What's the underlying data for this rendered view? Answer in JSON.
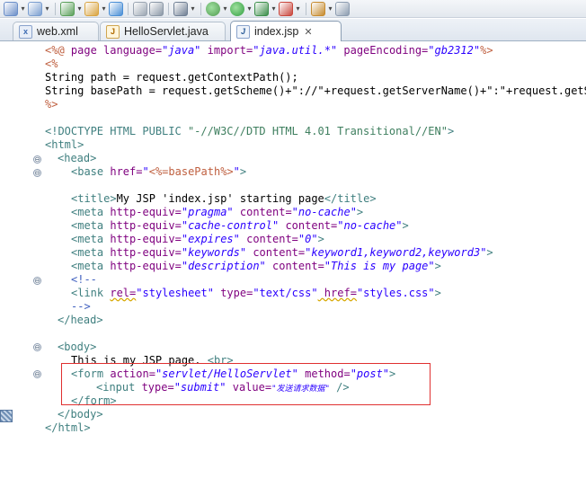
{
  "toolbar": {
    "icons": [
      "new-wizard-icon",
      "dropdown",
      "run-wizard-icon",
      "dropdown",
      "sep",
      "new-class-icon",
      "dropdown",
      "open-type-icon",
      "dropdown",
      "globe-icon",
      "sep",
      "disconnect-icon",
      "search-icon",
      "sep",
      "server-icon",
      "dropdown",
      "sep",
      "debug-icon",
      "dropdown",
      "run-icon",
      "dropdown",
      "coverage-icon",
      "dropdown",
      "external-tools-icon",
      "dropdown",
      "sep",
      "package-icon",
      "dropdown",
      "open-resource-icon"
    ]
  },
  "tabs": [
    {
      "label": "web.xml",
      "icon": "xml-file-icon",
      "active": false
    },
    {
      "label": "HelloServlet.java",
      "icon": "java-file-icon",
      "active": false
    },
    {
      "label": "index.jsp",
      "icon": "jsp-file-icon",
      "active": true,
      "close": "✕"
    }
  ],
  "code": {
    "l1": [
      "<%@ ",
      "page ",
      "language=",
      "\"java\"",
      " import=",
      "\"java.util.*\"",
      " pageEncoding=",
      "\"gb2312\"",
      "%>"
    ],
    "l2": "<%",
    "l3": "String path = request.getContextPath();",
    "l4": "String basePath = request.getScheme()+\"://\"+request.getServerName()+\":\"+request.getSer",
    "l5": "%>",
    "l7a": "<!DOCTYPE HTML PUBLIC ",
    "l7b": "\"-//W3C//DTD HTML 4.01 Transitional//EN\"",
    "l7c": ">",
    "l8": "<html>",
    "l9": "<head>",
    "l10a": "<base ",
    "l10b": "href=",
    "l10c": "\"",
    "l10d": "<%=basePath%>",
    "l10e": "\"",
    "l10f": ">",
    "l12a": "<title>",
    "l12b": "My JSP 'index.jsp' starting page",
    "l12c": "</title>",
    "meta_tag": "<meta ",
    "http_equiv": "http-equiv=",
    "content_attr": "content=",
    "close_gt": ">",
    "m1": [
      "\"pragma\"",
      "\"no-cache\""
    ],
    "m2": [
      "\"cache-control\"",
      "\"no-cache\""
    ],
    "m3": [
      "\"expires\"",
      "\"0\""
    ],
    "m4": [
      "\"keywords\"",
      "\"keyword1,keyword2,keyword3\""
    ],
    "m5": [
      "\"description\"",
      "\"This is my page\""
    ],
    "c1": "<!--",
    "link_tag": "<link ",
    "link_rel": "rel=",
    "link_rel_v": "\"stylesheet\"",
    "link_type": " type=",
    "link_type_v": "\"text/css\"",
    "link_href": " href=",
    "link_href_v": "\"styles.css\"",
    "c2": "-->",
    "l20": "</head>",
    "l22": "<body>",
    "l23a": "This is my JSP page. ",
    "l23b": "<br>",
    "l24a": "<form ",
    "l24b": "action=",
    "l24c": "\"servlet/HelloServlet\"",
    "l24d": " method=",
    "l24e": "\"post\"",
    "l24f": ">",
    "l25a": "<input ",
    "l25b": "type=",
    "l25c": "\"submit\"",
    "l25d": " value=",
    "l25e": "\"发送请求数据\"",
    "l25f": " />",
    "l26": "</form>",
    "l27": "</body>",
    "l28": "</html>"
  },
  "folds": [
    "⊖",
    "⊖",
    "⊖",
    "⊖",
    "⊖",
    "⊖"
  ],
  "colors": {
    "tag": "#3f7f7f",
    "attribute": "#7f007f",
    "string": "#2a00ff",
    "jsp": "#bf5f3f",
    "comment": "#3f5fbf",
    "highlight_box": "#e03030"
  }
}
